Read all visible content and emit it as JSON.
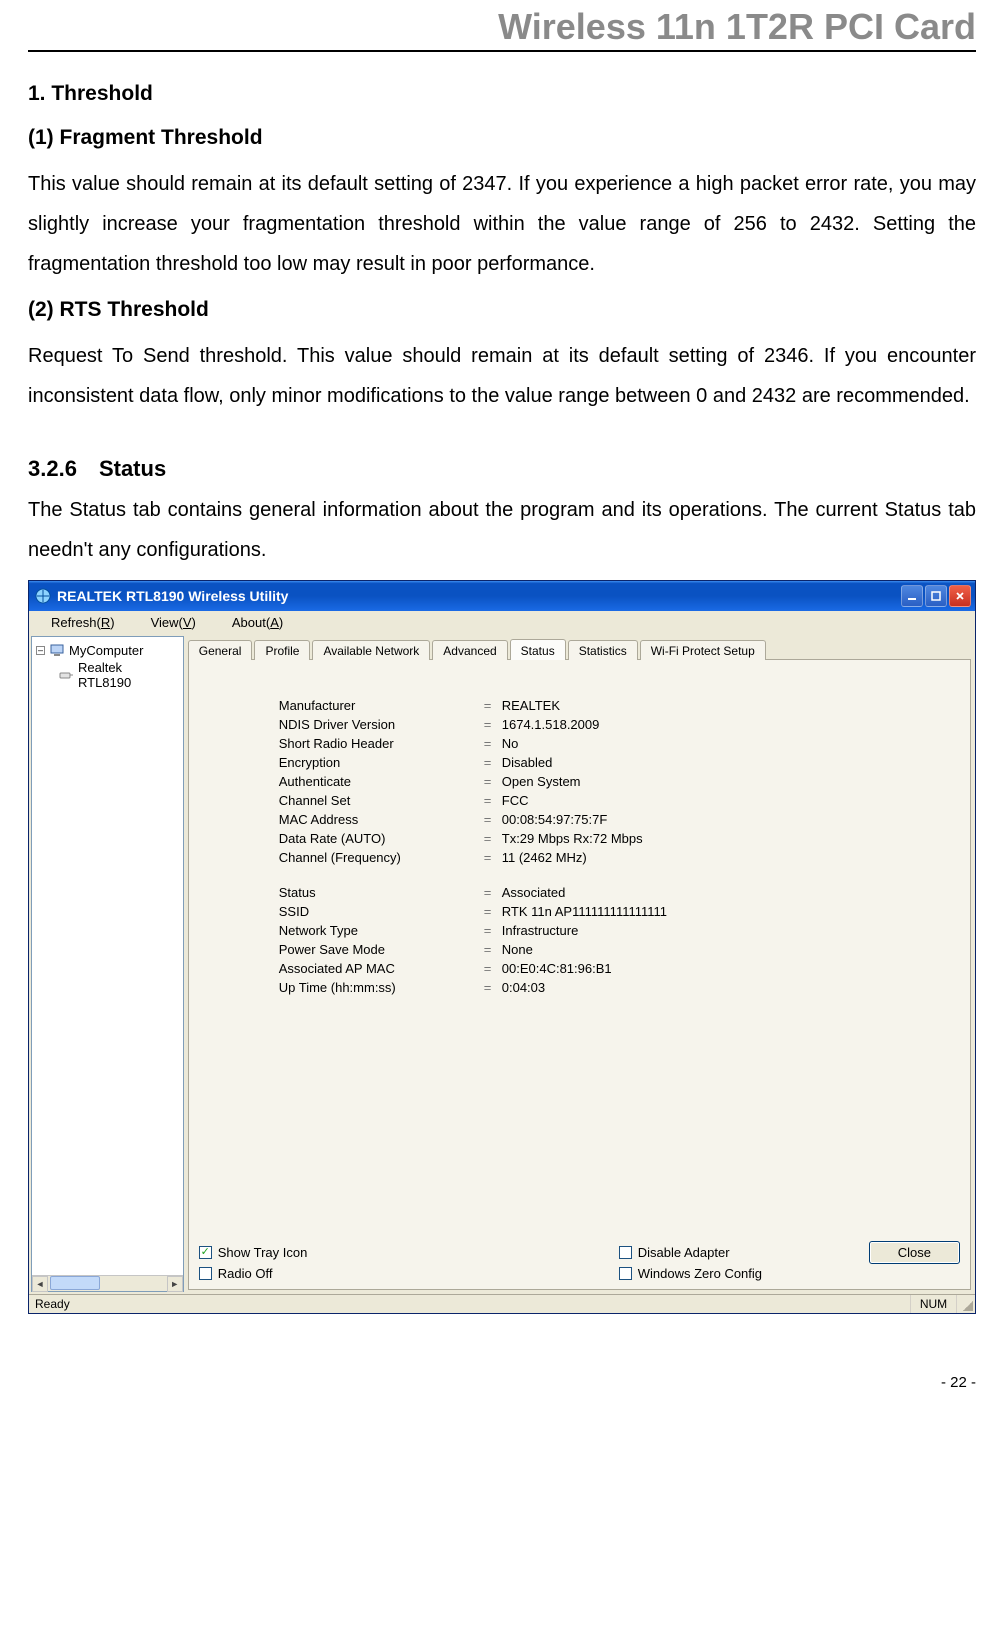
{
  "page": {
    "header_title": "Wireless 11n 1T2R PCI Card",
    "page_number": "- 22 -"
  },
  "doc": {
    "h_threshold": "1. Threshold",
    "h_frag": "(1) Fragment Threshold",
    "p_frag": "This value should remain at its default setting of 2347. If you experience a high packet error rate, you may slightly increase your fragmentation threshold within the value range of 256 to 2432. Setting the fragmentation threshold too low may result in poor performance.",
    "h_rts": "(2) RTS Threshold",
    "p_rts": "Request To Send threshold. This value should remain at its default setting of 2346. If you encounter inconsistent data flow, only minor modifications to the value range between 0 and 2432 are recommended.",
    "sec_num": "3.2.6",
    "sec_title": "Status",
    "p_status_intro": "The Status tab contains general information about the program and its operations. The current Status tab needn't any configurations."
  },
  "window": {
    "title": "REALTEK RTL8190 Wireless Utility",
    "menus": {
      "refresh": "Refresh(R)",
      "view": "View(V)",
      "about": "About(A)"
    },
    "tree": {
      "root": "MyComputer",
      "child": "Realtek RTL8190"
    },
    "tabs": [
      "General",
      "Profile",
      "Available Network",
      "Advanced",
      "Status",
      "Statistics",
      "Wi-Fi Protect Setup"
    ],
    "active_tab_index": 4,
    "status_rows_a": [
      {
        "label": "Manufacturer",
        "value": "REALTEK"
      },
      {
        "label": "NDIS Driver Version",
        "value": "1674.1.518.2009"
      },
      {
        "label": "Short Radio Header",
        "value": "No"
      },
      {
        "label": "Encryption",
        "value": "Disabled"
      },
      {
        "label": "Authenticate",
        "value": "Open System"
      },
      {
        "label": "Channel Set",
        "value": "FCC"
      },
      {
        "label": "MAC Address",
        "value": "00:08:54:97:75:7F"
      },
      {
        "label": "Data Rate (AUTO)",
        "value": "Tx:29 Mbps Rx:72 Mbps"
      },
      {
        "label": "Channel (Frequency)",
        "value": "11 (2462 MHz)"
      }
    ],
    "status_rows_b": [
      {
        "label": "Status",
        "value": "Associated"
      },
      {
        "label": "SSID",
        "value": "RTK 11n AP111111111111111"
      },
      {
        "label": "Network Type",
        "value": "Infrastructure"
      },
      {
        "label": "Power Save Mode",
        "value": "None"
      },
      {
        "label": "Associated AP MAC",
        "value": "00:E0:4C:81:96:B1"
      },
      {
        "label": "Up Time (hh:mm:ss)",
        "value": "0:04:03"
      }
    ],
    "checkboxes": {
      "show_tray": {
        "label": "Show Tray Icon",
        "checked": true
      },
      "radio_off": {
        "label": "Radio Off",
        "checked": false
      },
      "disable_adapter": {
        "label": "Disable Adapter",
        "checked": false
      },
      "win_zero": {
        "label": "Windows Zero Config",
        "checked": false
      }
    },
    "close_button": "Close",
    "statusbar": {
      "ready": "Ready",
      "num": "NUM"
    }
  }
}
